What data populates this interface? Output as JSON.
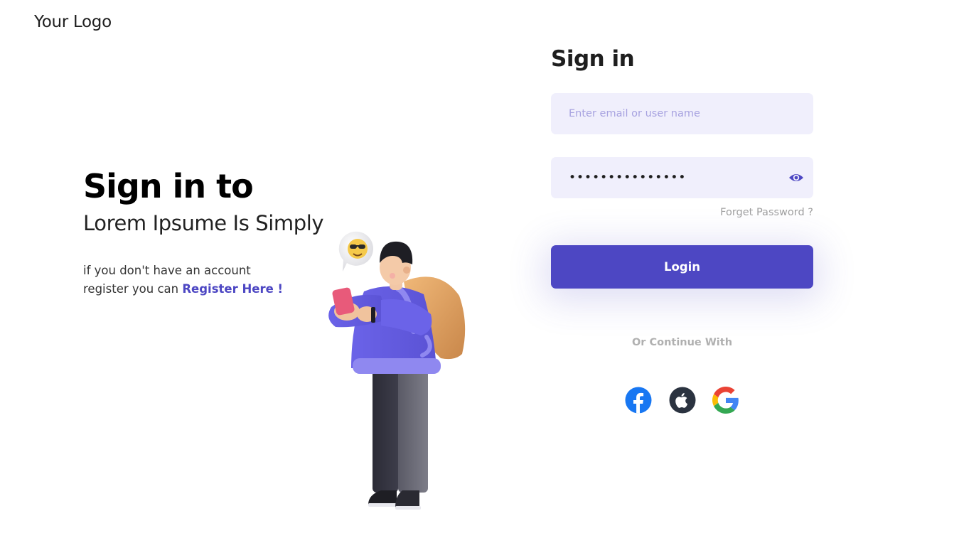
{
  "header": {
    "logo_text": "Your Logo"
  },
  "hero": {
    "title": "Sign in to",
    "subtitle": "Lorem Ipsume Is Simply",
    "register_prefix": "if you don't have an account register you can ",
    "register_link": "Register Here !"
  },
  "form": {
    "title": "Sign in",
    "email": {
      "placeholder": "Enter email or user name",
      "value": ""
    },
    "password": {
      "value": "•••••••••••••••",
      "toggle_icon": "eye-icon"
    },
    "forget_label": "Forget Password ?",
    "login_label": "Login",
    "divider_label": "Or Continue With",
    "social": [
      {
        "name": "Facebook",
        "icon": "facebook-icon"
      },
      {
        "name": "Apple",
        "icon": "apple-icon"
      },
      {
        "name": "Google",
        "icon": "google-icon"
      }
    ]
  },
  "colors": {
    "primary": "#4d47c3",
    "input_bg": "#f0effc",
    "placeholder": "#a7a2e0",
    "muted_text": "#a0a0a0",
    "facebook": "#1877f2",
    "apple": "#2b3340"
  }
}
